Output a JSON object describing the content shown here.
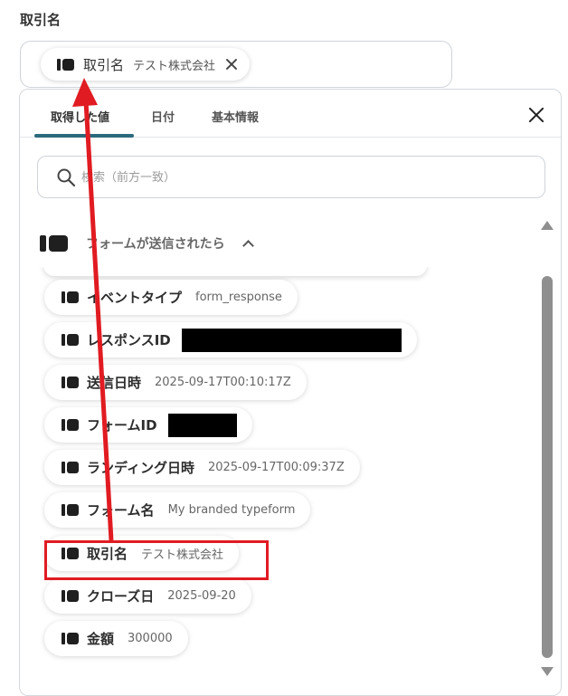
{
  "field": {
    "label": "取引名",
    "chip": {
      "label": "取引名",
      "value": "テスト株式会社"
    }
  },
  "popup": {
    "tabs": [
      {
        "label": "取得した値",
        "active": true
      },
      {
        "label": "日付",
        "active": false
      },
      {
        "label": "基本情報",
        "active": false
      }
    ],
    "search": {
      "placeholder": "検索（前方一致）",
      "value": ""
    },
    "group": {
      "title": "フォームが送信されたら"
    },
    "items": [
      {
        "label": "イベントタイプ",
        "value": "form_response"
      },
      {
        "label": "レスポンスID",
        "value": "",
        "redacted": true
      },
      {
        "label": "送信日時",
        "value": "2025-09-17T00:10:17Z"
      },
      {
        "label": "フォームID",
        "value": "",
        "redacted": true
      },
      {
        "label": "ランディング日時",
        "value": "2025-09-17T00:09:37Z"
      },
      {
        "label": "フォーム名",
        "value": "My branded typeform"
      },
      {
        "label": "取引名",
        "value": "テスト株式会社",
        "highlighted": true
      },
      {
        "label": "クローズ日",
        "value": "2025-09-20"
      },
      {
        "label": "金額",
        "value": "300000"
      }
    ]
  },
  "colors": {
    "accent": "#2b6a7d",
    "annotation_red": "#e11b22",
    "scrollbar": "#8f8f8f"
  },
  "icons": {
    "value_icon": "block-icon",
    "close": "close-icon",
    "search": "search-icon",
    "collapse": "chevron-up-icon"
  }
}
